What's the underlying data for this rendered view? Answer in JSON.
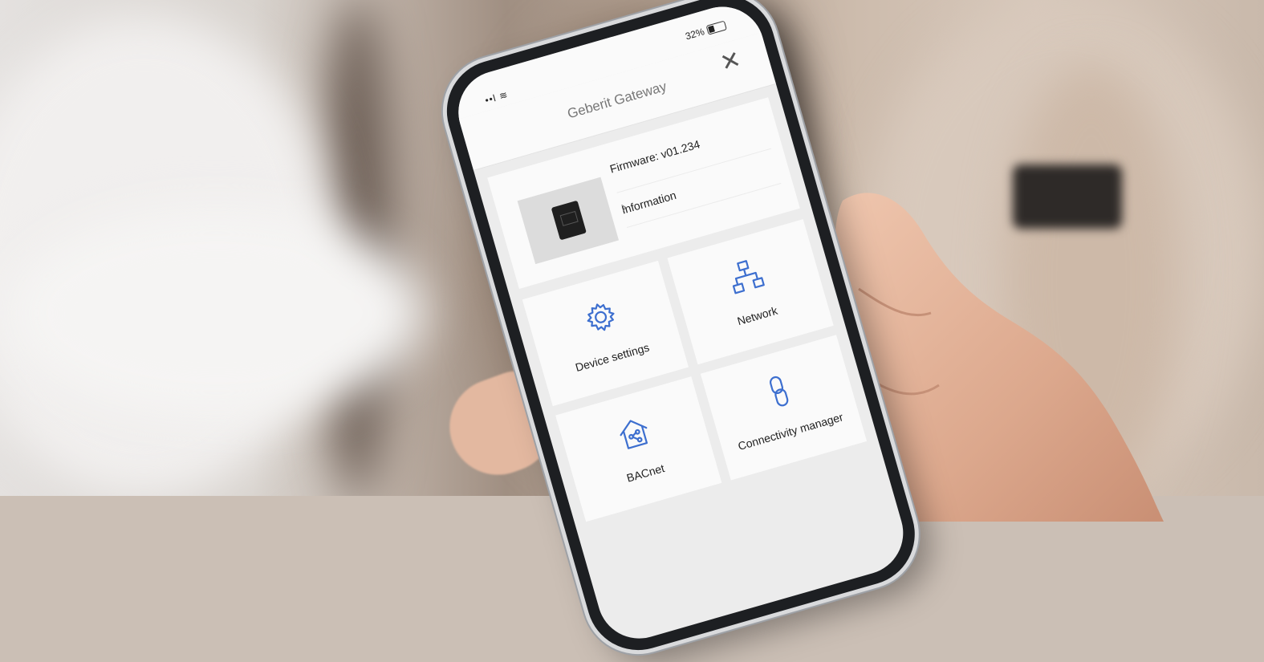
{
  "status": {
    "signal": "••l ≋",
    "battery": "32%"
  },
  "header": {
    "title": "Geberit Gateway",
    "close_glyph": "✕"
  },
  "device": {
    "firmware": "Firmware: v01.234",
    "info_label": "Information",
    "info_chevron": "›"
  },
  "tiles": [
    {
      "label": "Device settings",
      "icon": "gear-icon"
    },
    {
      "label": "Network",
      "icon": "network-icon"
    },
    {
      "label": "BACnet",
      "icon": "bacnet-house-icon"
    },
    {
      "label": "Connectivity manager",
      "icon": "link-chain-icon"
    }
  ],
  "colors": {
    "accent": "#3d6fcf",
    "tile_bg": "#fafafa",
    "screen_bg": "#ececec"
  }
}
